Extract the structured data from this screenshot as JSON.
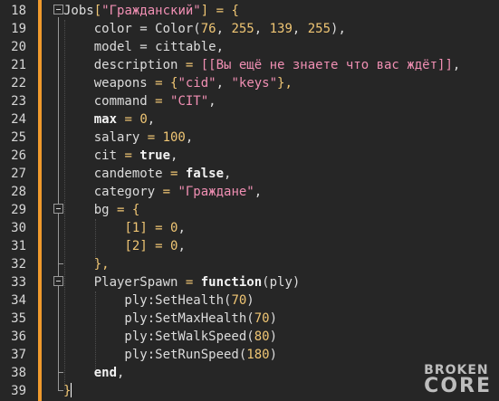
{
  "gutter": {
    "line_numbers": [
      "18",
      "19",
      "20",
      "21",
      "22",
      "23",
      "24",
      "25",
      "26",
      "27",
      "28",
      "29",
      "30",
      "31",
      "32",
      "33",
      "34",
      "35",
      "36",
      "37",
      "38",
      "39"
    ]
  },
  "code": [
    [
      {
        "t": "Jobs",
        "c": "id"
      },
      {
        "t": "[",
        "c": "op"
      },
      {
        "t": "\"Гражданский\"",
        "c": "str"
      },
      {
        "t": "] = {",
        "c": "op"
      }
    ],
    [
      {
        "t": "    color = Color(",
        "c": "id"
      },
      {
        "t": "76",
        "c": "num"
      },
      {
        "t": ", ",
        "c": "id"
      },
      {
        "t": "255",
        "c": "num"
      },
      {
        "t": ", ",
        "c": "id"
      },
      {
        "t": "139",
        "c": "num"
      },
      {
        "t": ", ",
        "c": "id"
      },
      {
        "t": "255",
        "c": "num"
      },
      {
        "t": "),",
        "c": "id"
      }
    ],
    [
      {
        "t": "    model = cittable,",
        "c": "id"
      }
    ],
    [
      {
        "t": "    description ",
        "c": "id"
      },
      {
        "t": "= ",
        "c": "op"
      },
      {
        "t": "[[Вы ещё не знаете что вас ждёт]]",
        "c": "str"
      },
      {
        "t": ",",
        "c": "id"
      }
    ],
    [
      {
        "t": "    weapons ",
        "c": "id"
      },
      {
        "t": "= {",
        "c": "op"
      },
      {
        "t": "\"cid\"",
        "c": "str"
      },
      {
        "t": ", ",
        "c": "id"
      },
      {
        "t": "\"keys\"",
        "c": "str"
      },
      {
        "t": "},",
        "c": "op"
      }
    ],
    [
      {
        "t": "    command ",
        "c": "id"
      },
      {
        "t": "= ",
        "c": "op"
      },
      {
        "t": "\"CIT\"",
        "c": "str"
      },
      {
        "t": ",",
        "c": "id"
      }
    ],
    [
      {
        "t": "    ",
        "c": "id"
      },
      {
        "t": "max",
        "c": "kw"
      },
      {
        "t": " = ",
        "c": "op"
      },
      {
        "t": "0",
        "c": "num"
      },
      {
        "t": ",",
        "c": "id"
      }
    ],
    [
      {
        "t": "    salary ",
        "c": "id"
      },
      {
        "t": "= ",
        "c": "op"
      },
      {
        "t": "100",
        "c": "num"
      },
      {
        "t": ",",
        "c": "id"
      }
    ],
    [
      {
        "t": "    cit ",
        "c": "id"
      },
      {
        "t": "= ",
        "c": "op"
      },
      {
        "t": "true",
        "c": "kw"
      },
      {
        "t": ",",
        "c": "id"
      }
    ],
    [
      {
        "t": "    candemote ",
        "c": "id"
      },
      {
        "t": "= ",
        "c": "op"
      },
      {
        "t": "false",
        "c": "kw"
      },
      {
        "t": ",",
        "c": "id"
      }
    ],
    [
      {
        "t": "    category ",
        "c": "id"
      },
      {
        "t": "= ",
        "c": "op"
      },
      {
        "t": "\"Граждане\"",
        "c": "str"
      },
      {
        "t": ",",
        "c": "id"
      }
    ],
    [
      {
        "t": "    bg ",
        "c": "id"
      },
      {
        "t": "= {",
        "c": "op"
      }
    ],
    [
      {
        "t": "        ",
        "c": "id"
      },
      {
        "t": "[",
        "c": "op"
      },
      {
        "t": "1",
        "c": "num"
      },
      {
        "t": "] = ",
        "c": "op"
      },
      {
        "t": "0",
        "c": "num"
      },
      {
        "t": ",",
        "c": "id"
      }
    ],
    [
      {
        "t": "        ",
        "c": "id"
      },
      {
        "t": "[",
        "c": "op"
      },
      {
        "t": "2",
        "c": "num"
      },
      {
        "t": "] = ",
        "c": "op"
      },
      {
        "t": "0",
        "c": "num"
      },
      {
        "t": ",",
        "c": "id"
      }
    ],
    [
      {
        "t": "    ",
        "c": "id"
      },
      {
        "t": "},",
        "c": "op"
      }
    ],
    [
      {
        "t": "    PlayerSpawn ",
        "c": "id"
      },
      {
        "t": "= ",
        "c": "op"
      },
      {
        "t": "function",
        "c": "kw"
      },
      {
        "t": "(ply)",
        "c": "id"
      }
    ],
    [
      {
        "t": "        ply:SetHealth(",
        "c": "id"
      },
      {
        "t": "70",
        "c": "num"
      },
      {
        "t": ")",
        "c": "id"
      }
    ],
    [
      {
        "t": "        ply:SetMaxHealth(",
        "c": "id"
      },
      {
        "t": "70",
        "c": "num"
      },
      {
        "t": ")",
        "c": "id"
      }
    ],
    [
      {
        "t": "        ply:SetWalkSpeed(",
        "c": "id"
      },
      {
        "t": "80",
        "c": "num"
      },
      {
        "t": ")",
        "c": "id"
      }
    ],
    [
      {
        "t": "        ply:SetRunSpeed(",
        "c": "id"
      },
      {
        "t": "180",
        "c": "num"
      },
      {
        "t": ")",
        "c": "id"
      }
    ],
    [
      {
        "t": "    ",
        "c": "id"
      },
      {
        "t": "end",
        "c": "kw"
      },
      {
        "t": ",",
        "c": "id"
      }
    ],
    [
      {
        "t": "}",
        "c": "op"
      }
    ]
  ],
  "watermark": {
    "line1": "BROKEN",
    "line2": "CORE"
  },
  "colors": {
    "accent_bar": "#f09a2d",
    "background": "#262626",
    "string": "#f08fb3",
    "number": "#f0c674"
  }
}
